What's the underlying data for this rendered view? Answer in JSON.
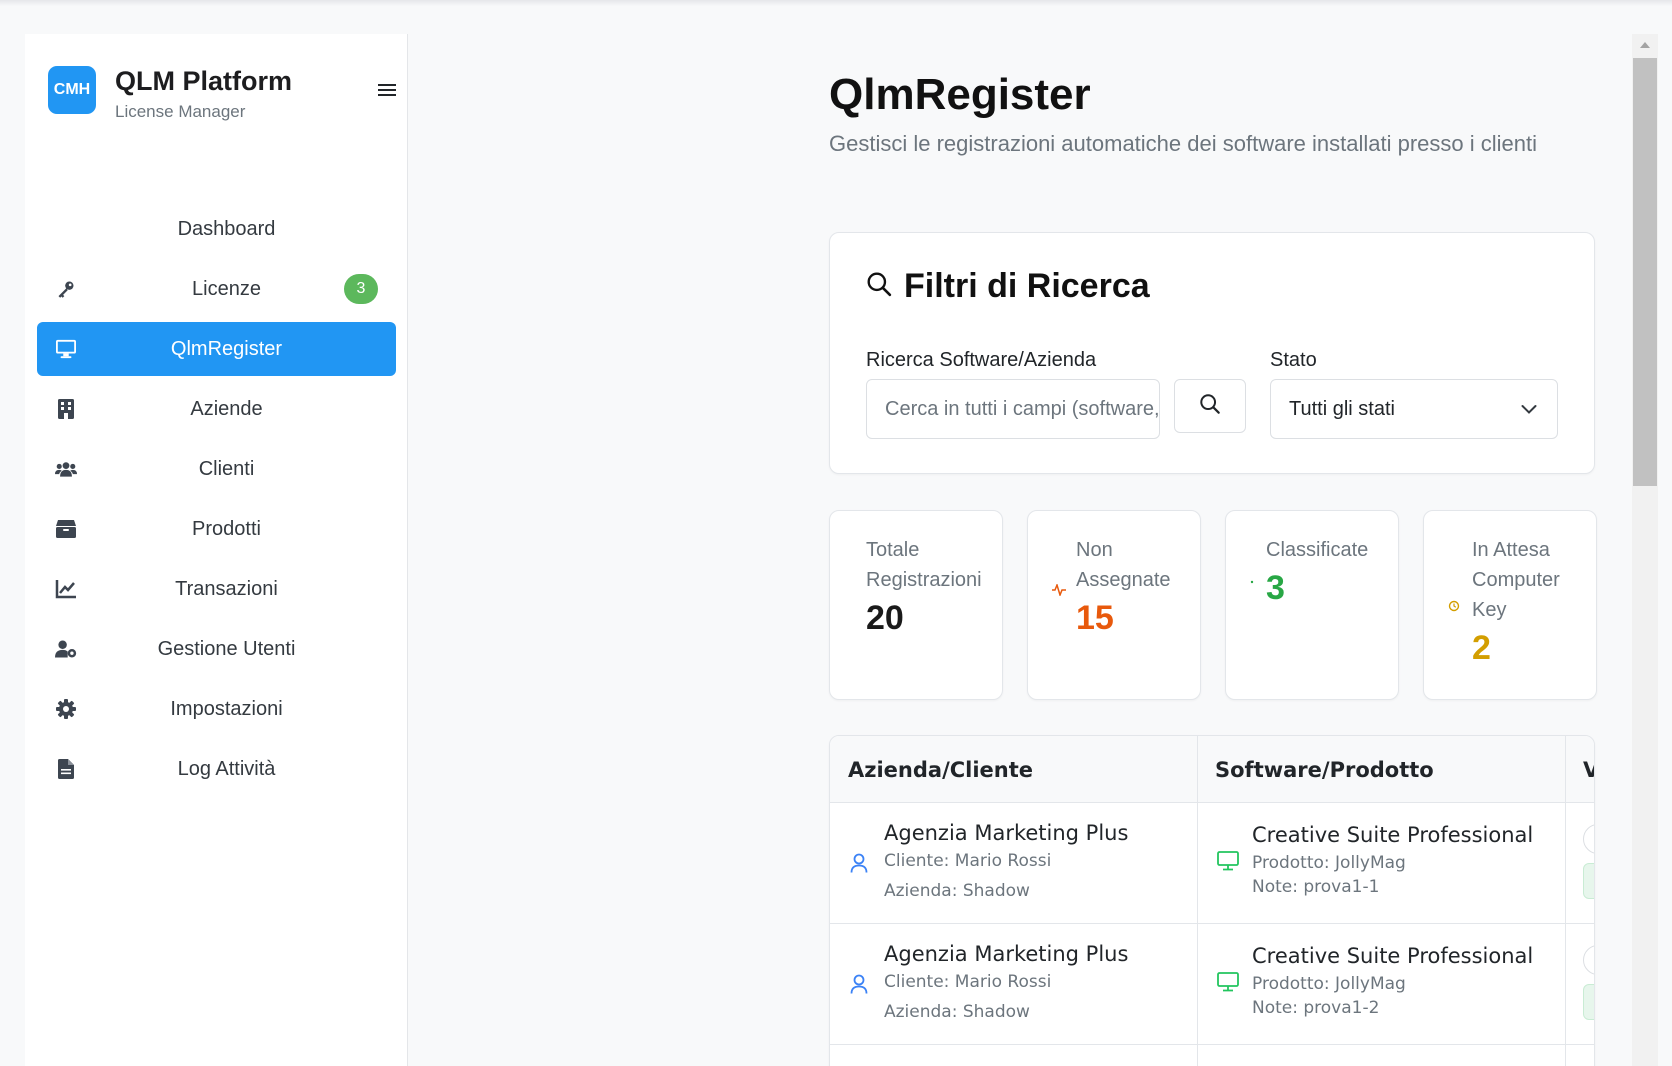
{
  "brand": {
    "logo": "CMH",
    "title": "QLM Platform",
    "subtitle": "License Manager"
  },
  "nav": [
    {
      "label": "Dashboard",
      "icon": "none"
    },
    {
      "label": "Licenze",
      "icon": "key-icon",
      "badge": "3"
    },
    {
      "label": "QlmRegister",
      "icon": "monitor-icon",
      "active": true
    },
    {
      "label": "Aziende",
      "icon": "building-icon"
    },
    {
      "label": "Clienti",
      "icon": "users-icon"
    },
    {
      "label": "Prodotti",
      "icon": "box-icon"
    },
    {
      "label": "Transazioni",
      "icon": "chart-line-icon"
    },
    {
      "label": "Gestione Utenti",
      "icon": "user-gear-icon"
    },
    {
      "label": "Impostazioni",
      "icon": "gear-icon"
    },
    {
      "label": "Log Attività",
      "icon": "file-icon"
    }
  ],
  "header": {
    "title": "QlmRegister",
    "subtitle": "Gestisci le registrazioni automatiche dei software installati presso i clienti"
  },
  "filters": {
    "title": "Filtri di Ricerca",
    "search_label": "Ricerca Software/Azienda",
    "search_placeholder": "Cerca in tutti i campi (software, azienda, cliente...)",
    "status_label": "Stato",
    "status_value": "Tutti gli stati"
  },
  "stats": [
    {
      "label": "Totale Registrazioni",
      "value": "20",
      "color": "#1a1a1a"
    },
    {
      "label": "Non Assegnate",
      "value": "15",
      "color": "#e8590c"
    },
    {
      "label": "Classificate",
      "value": "3",
      "color": "#28a745"
    },
    {
      "label": "In Attesa Computer Key",
      "value": "2",
      "color": "#d39e00"
    }
  ],
  "table": {
    "columns": [
      "Azienda/Cliente",
      "Software/Prodotto",
      "V"
    ],
    "rows": [
      {
        "company": "Agenzia Marketing Plus",
        "client": "Cliente: Mario Rossi",
        "azienda": "Azienda: Shadow",
        "software": "Creative Suite Professional",
        "product": "Prodotto: JollyMag",
        "note": "Note: prova1-1"
      },
      {
        "company": "Agenzia Marketing Plus",
        "client": "Cliente: Mario Rossi",
        "azienda": "Azienda: Shadow",
        "software": "Creative Suite Professional",
        "product": "Prodotto: JollyMag",
        "note": "Note: prova1-2"
      }
    ]
  },
  "colors": {
    "primary": "#2196f3",
    "badge": "#5cb85c",
    "user_icon": "#3b82f6",
    "monitor_icon": "#22c55e"
  }
}
